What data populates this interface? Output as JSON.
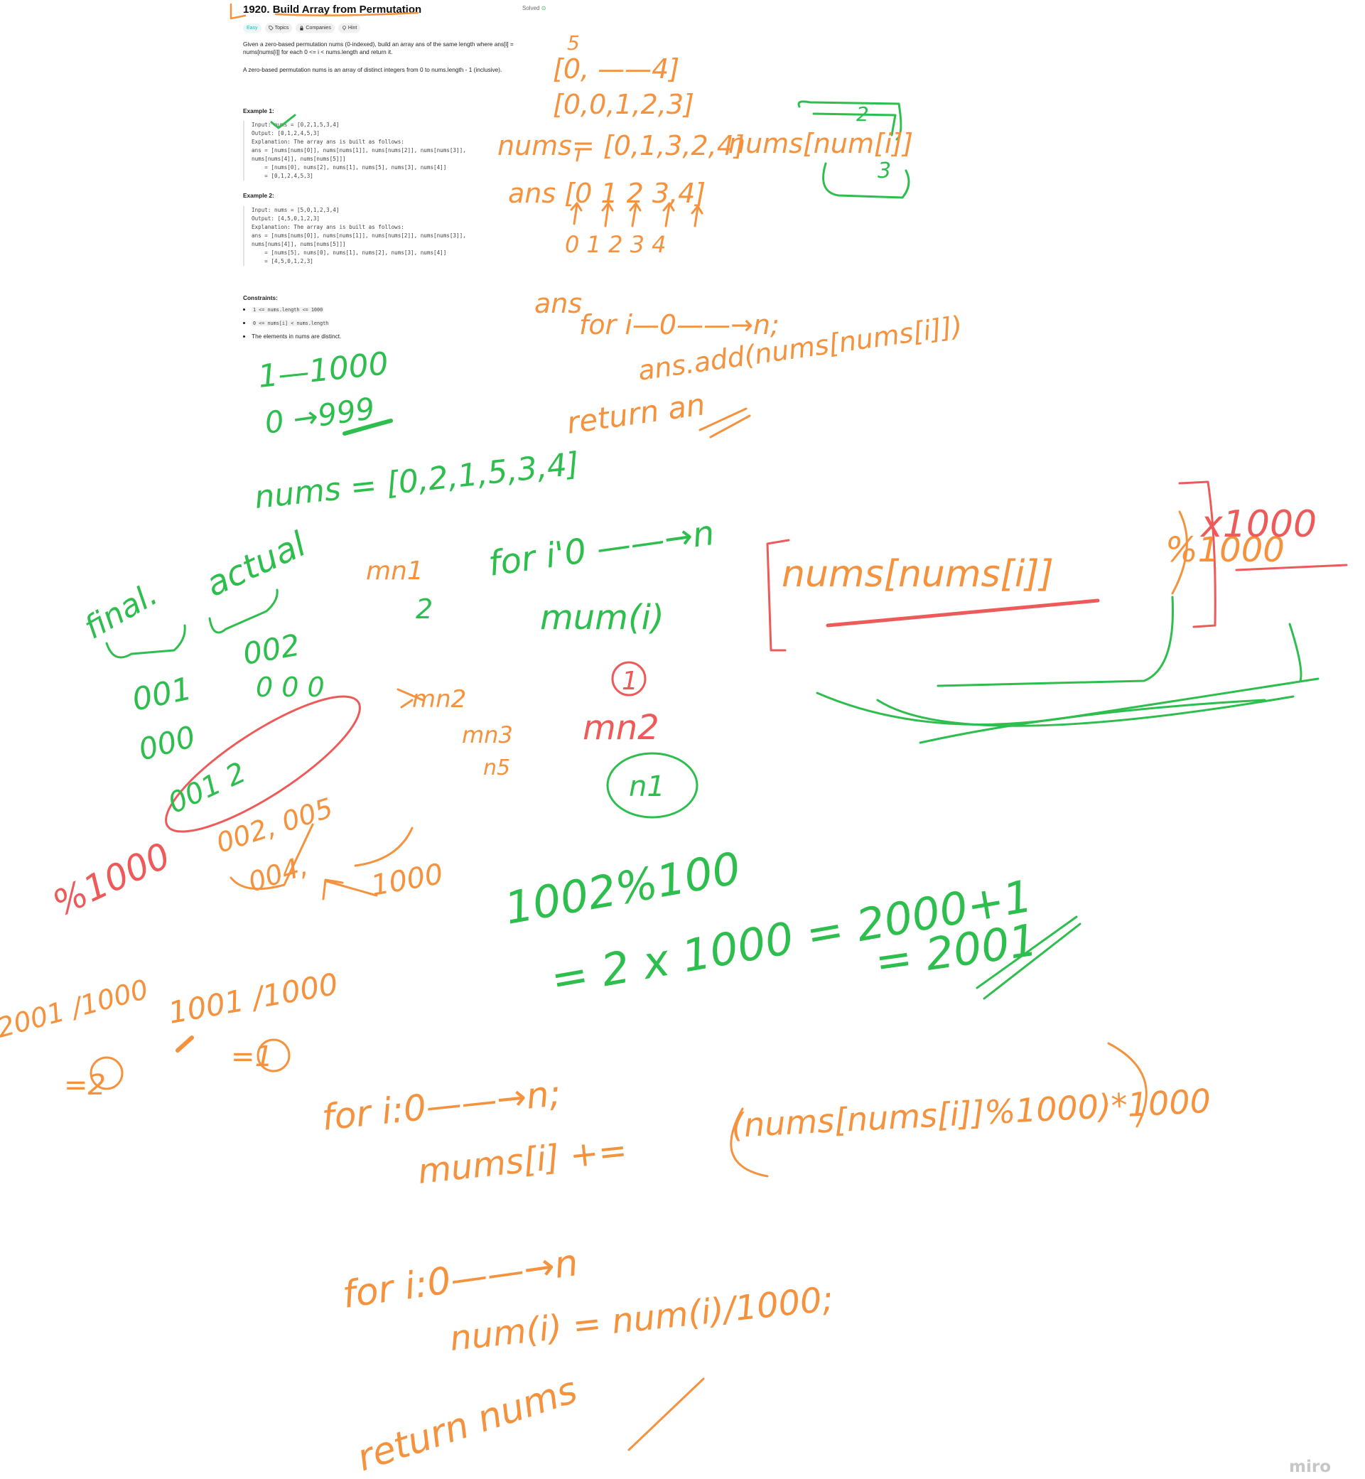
{
  "problem": {
    "title": "1920. Build Array from Permutation",
    "status": "Solved",
    "tags": [
      "Easy",
      "Topics",
      "Companies",
      "Hint"
    ],
    "desc_1": "Given a zero-based permutation nums (0-indexed), build an array ans of the same length where ans[i] = nums[nums[i]] for each 0 <= i < nums.length and return it.",
    "desc_2": "A zero-based permutation nums is an array of distinct integers from 0 to nums.length - 1 (inclusive).",
    "example1": {
      "title": "Example 1:",
      "lines": [
        "Input: nums = [0,2,1,5,3,4]",
        "Output: [0,1,2,4,5,3]",
        "Explanation: The array ans is built as follows:",
        "ans = [nums[nums[0]], nums[nums[1]], nums[nums[2]], nums[nums[3]],",
        "nums[nums[4]], nums[nums[5]]]",
        "    = [nums[0], nums[2], nums[1], nums[5], nums[3], nums[4]]",
        "    = [0,1,2,4,5,3]"
      ]
    },
    "example2": {
      "title": "Example 2:",
      "lines": [
        "Input: nums = [5,0,1,2,3,4]",
        "Output: [4,5,0,1,2,3]",
        "Explanation: The array ans is built as follows:",
        "ans = [nums[nums[0]], nums[nums[1]], nums[nums[2]], nums[nums[3]],",
        "nums[nums[4]], nums[nums[5]]]",
        "    = [nums[5], nums[0], nums[1], nums[2], nums[3], nums[4]]",
        "    = [4,5,0,1,2,3]"
      ]
    },
    "constraints_title": "Constraints:",
    "constraints": [
      "1 <= nums.length <= 1000",
      "0 <= nums[i] < nums.length",
      "The elements in nums are distinct."
    ]
  },
  "notes": {
    "orange": [
      "5",
      "[0, ——4]",
      "[0,0,1,2,3]",
      "nums= [0,1,3,2,4]",
      "nums[num[i]]",
      "ans [0 1 2 3,4]",
      "0 1 2 3 4",
      "ans",
      "for i—0——→n;",
      "ans.add(nums[nums[i]])",
      "return an",
      "nums[nums[i]]",
      "%1000",
      "mn1",
      "mn2",
      "mn3",
      "n5",
      "002,   005",
      "004,",
      "1000",
      "1001 /1000",
      "=1",
      "2001 /1000",
      "=2",
      "for i:0——→n;",
      "mums[i] +=",
      "(nums[nums[i]]%1000)*1000",
      "for i:0——→n",
      "num(i) = num(i)/1000;",
      "return nums"
    ],
    "green": [
      "2",
      "3",
      "1—1000",
      "0 →999",
      "nums = [0,2,1,5,3,4]",
      "final.",
      "actual",
      "for i'0 ——→n",
      "mum(i)",
      "001",
      "002",
      "000",
      "001 2",
      "0 0 0",
      "2",
      "n1",
      "1002%100",
      "= 2 x 1000 = 2000+1",
      "= 2001"
    ],
    "red": [
      "x1000",
      "1",
      "mn2",
      "%1000"
    ]
  },
  "watermark": "miro",
  "colors": {
    "orange": "#F5923E",
    "green": "#2DBE4E",
    "red": "#EE5A5A"
  }
}
